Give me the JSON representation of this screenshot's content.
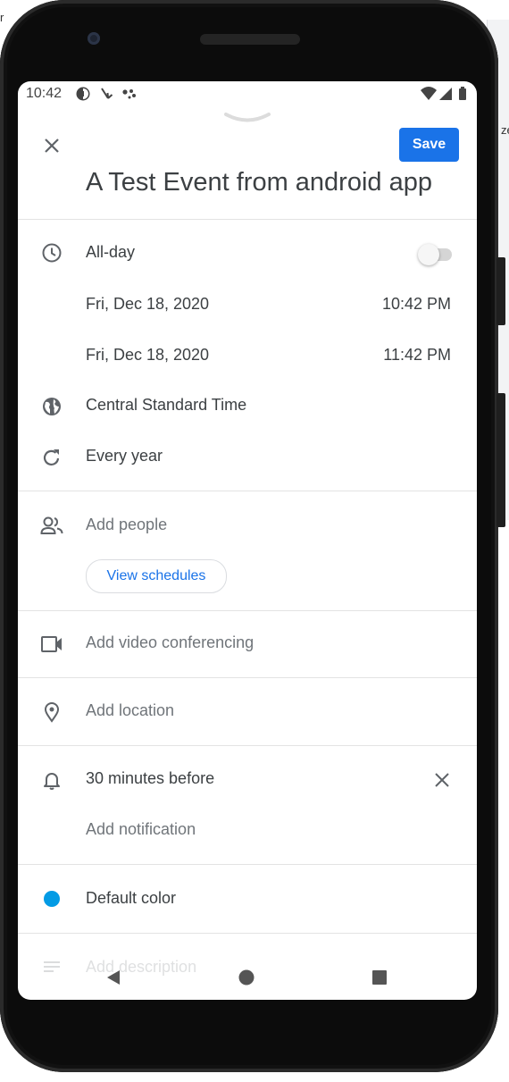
{
  "edge_text": {
    "left": "r",
    "right": "ze"
  },
  "status_bar": {
    "time": "10:42",
    "left_icons": [
      "data-saver-icon",
      "missed-call-icon",
      "assistant-dots-icon"
    ],
    "right_icons": [
      "wifi-icon",
      "cell-signal-icon",
      "battery-icon"
    ]
  },
  "header": {
    "save_label": "Save",
    "title": "A Test Event from android app"
  },
  "time_section": {
    "all_day_label": "All-day",
    "all_day_enabled": false,
    "start_date": "Fri, Dec 18, 2020",
    "start_time": "10:42 PM",
    "end_date": "Fri, Dec 18, 2020",
    "end_time": "11:42 PM",
    "timezone": "Central Standard Time",
    "repeat": "Every year"
  },
  "people": {
    "add_people_label": "Add people",
    "view_schedules_label": "View schedules"
  },
  "conferencing": {
    "label": "Add video conferencing"
  },
  "location": {
    "label": "Add location"
  },
  "notifications": {
    "items": [
      "30 minutes before"
    ],
    "add_label": "Add notification"
  },
  "event_color": {
    "label": "Default color",
    "color": "#039be5"
  },
  "description": {
    "label": "Add description"
  },
  "colors": {
    "accent": "#1a73e8",
    "text": "#3c4043",
    "muted": "#70757a",
    "icon": "#5f6368"
  },
  "nav_icons": [
    "back-icon",
    "home-icon",
    "recents-icon"
  ]
}
